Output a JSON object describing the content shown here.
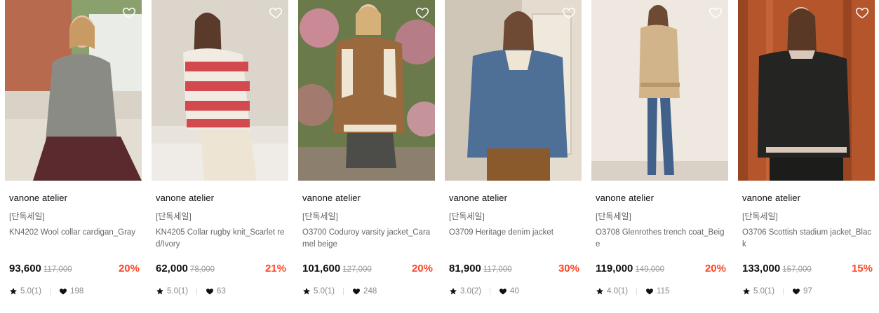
{
  "products": [
    {
      "brand": "vanone atelier",
      "tag": "[단독세일]",
      "name": "KN4202 Wool collar cardigan_Gray",
      "price": "93,600",
      "original_price": "117,000",
      "discount": "20%",
      "rating": "5.0(1)",
      "likes": "198",
      "image_icon": "model-gray-cardigan-photo"
    },
    {
      "brand": "vanone atelier",
      "tag": "[단독세일]",
      "name": "KN4205 Collar rugby knit_Scarlet red/Ivory",
      "price": "62,000",
      "original_price": "78,000",
      "discount": "21%",
      "rating": "5.0(1)",
      "likes": "63",
      "image_icon": "model-striped-rugby-knit-photo"
    },
    {
      "brand": "vanone atelier",
      "tag": "[단독세일]",
      "name": "O3700 Coduroy varsity jacket_Caramel beige",
      "price": "101,600",
      "original_price": "127,000",
      "discount": "20%",
      "rating": "5.0(1)",
      "likes": "248",
      "image_icon": "model-caramel-varsity-jacket-photo"
    },
    {
      "brand": "vanone atelier",
      "tag": "[단독세일]",
      "name": "O3709 Heritage denim jacket",
      "price": "81,900",
      "original_price": "117,000",
      "discount": "30%",
      "rating": "3.0(2)",
      "likes": "40",
      "image_icon": "model-denim-jacket-photo"
    },
    {
      "brand": "vanone atelier",
      "tag": "[단독세일]",
      "name": "O3708 Glenrothes trench coat_Beige",
      "price": "119,000",
      "original_price": "149,000",
      "discount": "20%",
      "rating": "4.0(1)",
      "likes": "115",
      "image_icon": "model-beige-trench-coat-photo"
    },
    {
      "brand": "vanone atelier",
      "tag": "[단독세일]",
      "name": "O3706 Scottish stadium jacket_Black",
      "price": "133,000",
      "original_price": "157,000",
      "discount": "15%",
      "rating": "5.0(1)",
      "likes": "97",
      "image_icon": "model-black-stadium-jacket-photo"
    }
  ],
  "colors": {
    "discount": "#ff4524",
    "price": "#111111",
    "muted": "#888888"
  },
  "icons": {
    "wishlist": "heart-outline-icon",
    "rating": "star-icon",
    "likes": "heart-filled-icon"
  }
}
